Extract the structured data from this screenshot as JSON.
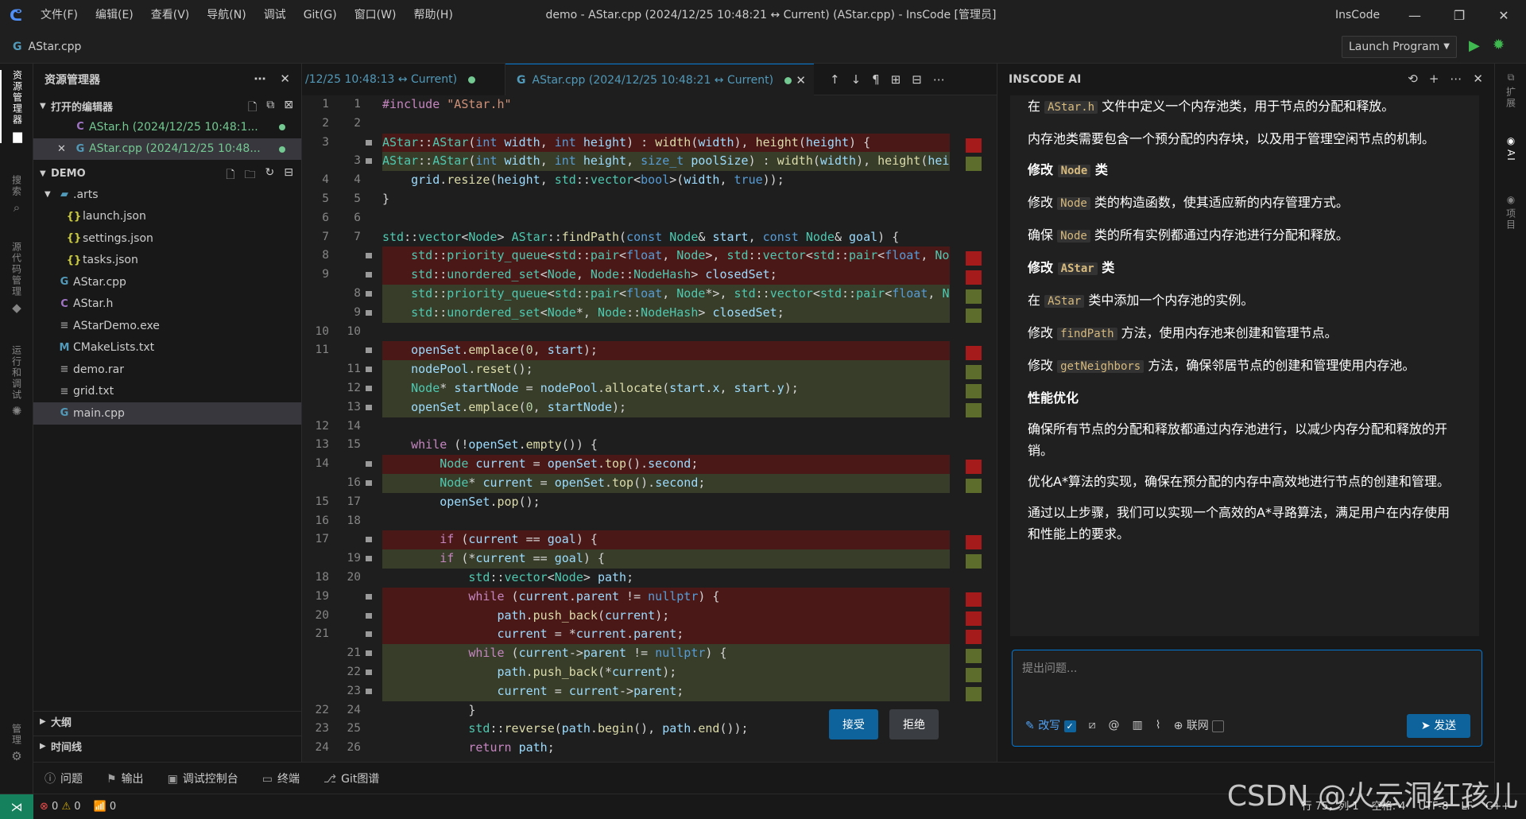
{
  "titlebar": {
    "menu": [
      "文件(F)",
      "编辑(E)",
      "查看(V)",
      "导航(N)",
      "调试",
      "Git(G)",
      "窗口(W)",
      "帮助(H)"
    ],
    "window_title": "demo - AStar.cpp (2024/12/25 10:48:21 ↔ Current) (AStar.cpp) - InsCode [管理员]",
    "app_name": "InsCode",
    "controls": [
      "—",
      "❐",
      "✕"
    ]
  },
  "pathbar": {
    "file": "AStar.cpp",
    "launch_label": "Launch Program"
  },
  "activity": {
    "explorer": "资源管理器",
    "search": "搜索",
    "scm": "源代码管理",
    "run": "运行和调试",
    "manage": "管理"
  },
  "explorer": {
    "title": "资源管理器",
    "open_editors_label": "打开的编辑器",
    "open_editors": [
      {
        "icon": "C",
        "name": "AStar.h (2024/12/25 10:48:1..."
      },
      {
        "icon": "C",
        "name": "AStar.cpp (2024/12/25 10:48..."
      }
    ],
    "project_label": "DEMO",
    "folder": ".arts",
    "folder_files": [
      "launch.json",
      "settings.json",
      "tasks.json"
    ],
    "files": [
      {
        "icon": "cpp",
        "name": "AStar.cpp"
      },
      {
        "icon": "c",
        "name": "AStar.h"
      },
      {
        "icon": "txt",
        "name": "AStarDemo.exe"
      },
      {
        "icon": "m",
        "name": "CMakeLists.txt"
      },
      {
        "icon": "txt",
        "name": "demo.rar"
      },
      {
        "icon": "txt",
        "name": "grid.txt"
      },
      {
        "icon": "cpp",
        "name": "main.cpp"
      }
    ],
    "outline_label": "大纲",
    "timeline_label": "时间线"
  },
  "editor": {
    "tab1": "/12/25 10:48:13 ↔ Current)",
    "tab2": "AStar.cpp (2024/12/25 10:48:21 ↔ Current)",
    "accept_label": "接受",
    "reject_label": "拒绝",
    "lines": [
      {
        "o": "1",
        "n": "1",
        "k": "",
        "t": "#include \"AStar.h\""
      },
      {
        "o": "2",
        "n": "2",
        "k": "",
        "t": ""
      },
      {
        "o": "3",
        "n": "",
        "k": "del",
        "t": "AStar::AStar(int width, int height) : width(width), height(height) {"
      },
      {
        "o": "",
        "n": "3",
        "k": "ins",
        "t": "AStar::AStar(int width, int height, size_t poolSize) : width(width), height(height), nodePool(poolSize) {"
      },
      {
        "o": "4",
        "n": "4",
        "k": "",
        "t": "    grid.resize(height, std::vector<bool>(width, true));"
      },
      {
        "o": "5",
        "n": "5",
        "k": "",
        "t": "}"
      },
      {
        "o": "6",
        "n": "6",
        "k": "",
        "t": ""
      },
      {
        "o": "7",
        "n": "7",
        "k": "",
        "t": "std::vector<Node> AStar::findPath(const Node& start, const Node& goal) {"
      },
      {
        "o": "8",
        "n": "",
        "k": "del",
        "t": "    std::priority_queue<std::pair<float, Node>, std::vector<std::pair<float, Node>>, std::greater<>> openSet;"
      },
      {
        "o": "9",
        "n": "",
        "k": "del",
        "t": "    std::unordered_set<Node, Node::NodeHash> closedSet;"
      },
      {
        "o": "",
        "n": "8",
        "k": "ins",
        "t": "    std::priority_queue<std::pair<float, Node*>, std::vector<std::pair<float, Node*>>, std::greater<>> openSet;"
      },
      {
        "o": "",
        "n": "9",
        "k": "ins",
        "t": "    std::unordered_set<Node*, Node::NodeHash> closedSet;"
      },
      {
        "o": "10",
        "n": "10",
        "k": "",
        "t": ""
      },
      {
        "o": "11",
        "n": "",
        "k": "del",
        "t": "    openSet.emplace(0, start);"
      },
      {
        "o": "",
        "n": "11",
        "k": "ins",
        "t": "    nodePool.reset();"
      },
      {
        "o": "",
        "n": "12",
        "k": "ins",
        "t": "    Node* startNode = nodePool.allocate(start.x, start.y);"
      },
      {
        "o": "",
        "n": "13",
        "k": "ins",
        "t": "    openSet.emplace(0, startNode);"
      },
      {
        "o": "12",
        "n": "14",
        "k": "",
        "t": ""
      },
      {
        "o": "13",
        "n": "15",
        "k": "",
        "t": "    while (!openSet.empty()) {"
      },
      {
        "o": "14",
        "n": "",
        "k": "del",
        "t": "        Node current = openSet.top().second;"
      },
      {
        "o": "",
        "n": "16",
        "k": "ins",
        "t": "        Node* current = openSet.top().second;"
      },
      {
        "o": "15",
        "n": "17",
        "k": "",
        "t": "        openSet.pop();"
      },
      {
        "o": "16",
        "n": "18",
        "k": "",
        "t": ""
      },
      {
        "o": "17",
        "n": "",
        "k": "del",
        "t": "        if (current == goal) {"
      },
      {
        "o": "",
        "n": "19",
        "k": "ins",
        "t": "        if (*current == goal) {"
      },
      {
        "o": "18",
        "n": "20",
        "k": "",
        "t": "            std::vector<Node> path;"
      },
      {
        "o": "19",
        "n": "",
        "k": "del",
        "t": "            while (current.parent != nullptr) {"
      },
      {
        "o": "20",
        "n": "",
        "k": "del",
        "t": "                path.push_back(current);"
      },
      {
        "o": "21",
        "n": "",
        "k": "del",
        "t": "                current = *current.parent;"
      },
      {
        "o": "",
        "n": "21",
        "k": "ins",
        "t": "            while (current->parent != nullptr) {"
      },
      {
        "o": "",
        "n": "22",
        "k": "ins",
        "t": "                path.push_back(*current);"
      },
      {
        "o": "",
        "n": "23",
        "k": "ins",
        "t": "                current = current->parent;"
      },
      {
        "o": "22",
        "n": "24",
        "k": "",
        "t": "            }"
      },
      {
        "o": "23",
        "n": "25",
        "k": "",
        "t": "            std::reverse(path.begin(), path.end());"
      },
      {
        "o": "24",
        "n": "26",
        "k": "",
        "t": "            return path;"
      }
    ]
  },
  "ai": {
    "title": "INSCODE AI",
    "input_placeholder": "提出问题...",
    "rewrite_label": "改写",
    "web_label": "联网",
    "send_label": "发送",
    "paras": [
      {
        "h": false,
        "parts": [
          [
            "在 ",
            false
          ],
          [
            "AStar.h",
            true
          ],
          [
            " 文件中定义一个内存池类，用于节点的分配和释放。",
            false
          ]
        ]
      },
      {
        "h": false,
        "parts": [
          [
            "内存池类需要包含一个预分配的内存块，以及用于管理空闲节点的机制。",
            false
          ]
        ]
      },
      {
        "h": true,
        "parts": [
          [
            "修改 ",
            false
          ],
          [
            "Node",
            true
          ],
          [
            " 类",
            false
          ]
        ]
      },
      {
        "h": false,
        "parts": [
          [
            "修改 ",
            false
          ],
          [
            "Node",
            true
          ],
          [
            " 类的构造函数，使其适应新的内存管理方式。",
            false
          ]
        ]
      },
      {
        "h": false,
        "parts": [
          [
            "确保 ",
            false
          ],
          [
            "Node",
            true
          ],
          [
            " 类的所有实例都通过内存池进行分配和释放。",
            false
          ]
        ]
      },
      {
        "h": true,
        "parts": [
          [
            "修改 ",
            false
          ],
          [
            "AStar",
            true
          ],
          [
            " 类",
            false
          ]
        ]
      },
      {
        "h": false,
        "parts": [
          [
            "在 ",
            false
          ],
          [
            "AStar",
            true
          ],
          [
            " 类中添加一个内存池的实例。",
            false
          ]
        ]
      },
      {
        "h": false,
        "parts": [
          [
            "修改 ",
            false
          ],
          [
            "findPath",
            true
          ],
          [
            " 方法，使用内存池来创建和管理节点。",
            false
          ]
        ]
      },
      {
        "h": false,
        "parts": [
          [
            "修改 ",
            false
          ],
          [
            "getNeighbors",
            true
          ],
          [
            " 方法，确保邻居节点的创建和管理使用内存池。",
            false
          ]
        ]
      },
      {
        "h": true,
        "parts": [
          [
            "性能优化",
            false
          ]
        ]
      },
      {
        "h": false,
        "parts": [
          [
            "确保所有节点的分配和释放都通过内存池进行，以减少内存分配和释放的开销。",
            false
          ]
        ]
      },
      {
        "h": false,
        "parts": [
          [
            "优化A*算法的实现，确保在预分配的内存中高效地进行节点的创建和管理。",
            false
          ]
        ]
      },
      {
        "h": false,
        "parts": [
          [
            "通过以上步骤，我们可以实现一个高效的A*寻路算法，满足用户在内存使用和性能上的要求。",
            false
          ]
        ]
      }
    ]
  },
  "rightrail": {
    "ext": "扩展",
    "ai": "AI",
    "project": "项目"
  },
  "panel_tabs": [
    "问题",
    "输出",
    "调试控制台",
    "终端",
    "Git图谱"
  ],
  "status": {
    "errors": "0",
    "warnings": "0",
    "ports": "0",
    "right": [
      "行 75，列 1",
      "空格: 4",
      "UTF-8",
      "LF",
      "C++"
    ]
  },
  "watermark": "CSDN @火云洞红孩儿",
  "colors": {
    "accent": "#0078d4",
    "deleted_line": "#4b1818",
    "inserted_line": "#373d29",
    "modified": "#73c991"
  }
}
